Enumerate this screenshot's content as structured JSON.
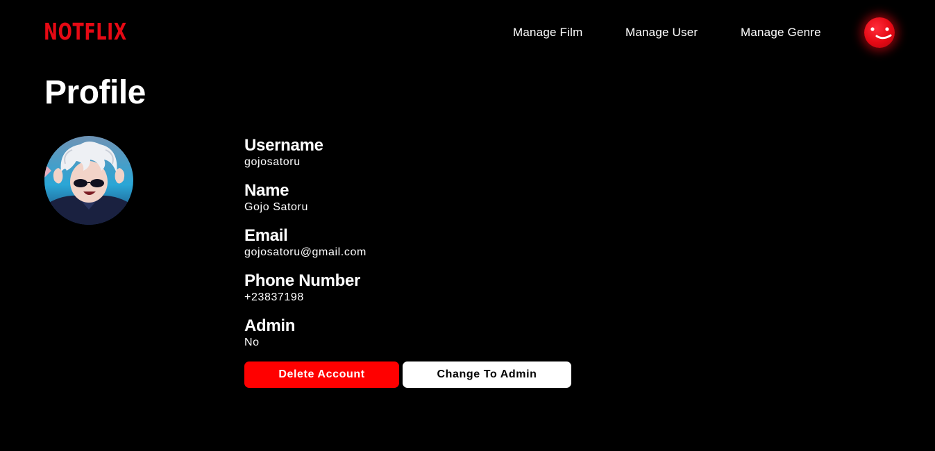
{
  "header": {
    "logo": "NOTFLIX",
    "nav": [
      {
        "label": "Manage Film"
      },
      {
        "label": "Manage User"
      },
      {
        "label": "Manage Genre"
      }
    ]
  },
  "page": {
    "title": "Profile"
  },
  "profile": {
    "fields": [
      {
        "label": "Username",
        "value": "gojosatoru"
      },
      {
        "label": "Name",
        "value": "Gojo Satoru"
      },
      {
        "label": "Email",
        "value": "gojosatoru@gmail.com"
      },
      {
        "label": "Phone Number",
        "value": "+23837198"
      },
      {
        "label": "Admin",
        "value": "No"
      }
    ]
  },
  "actions": {
    "delete_label": "Delete Account",
    "admin_label": "Change To Admin"
  },
  "colors": {
    "brand": "#e50914",
    "delete_button": "#ff0000",
    "background": "#000000"
  }
}
